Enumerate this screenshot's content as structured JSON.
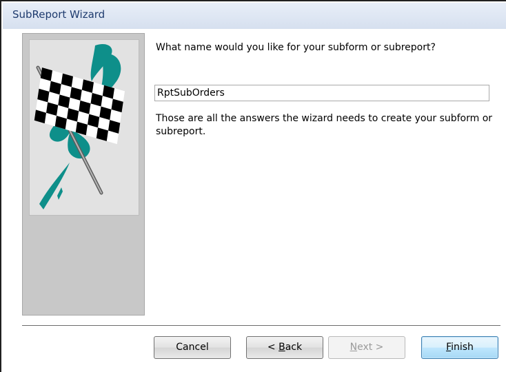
{
  "window": {
    "title": "SubReport Wizard"
  },
  "main": {
    "question": "What name would you like for your subform or subreport?",
    "name_value": "RptSubOrders",
    "info": "Those are all the answers the wizard needs to create your subform or subreport."
  },
  "buttons": {
    "cancel": "Cancel",
    "back_prefix": "< ",
    "back_mnemonic": "B",
    "back_rest": "ack",
    "next_mnemonic": "N",
    "next_rest": "ext >",
    "finish_mnemonic": "F",
    "finish_rest": "inish"
  },
  "colors": {
    "flag_teal": "#0e8f8a",
    "title_text": "#1e3b6e",
    "panel_gray": "#c8c8c8"
  },
  "icons": {
    "wizard_art": "checkered-flag-icon"
  }
}
